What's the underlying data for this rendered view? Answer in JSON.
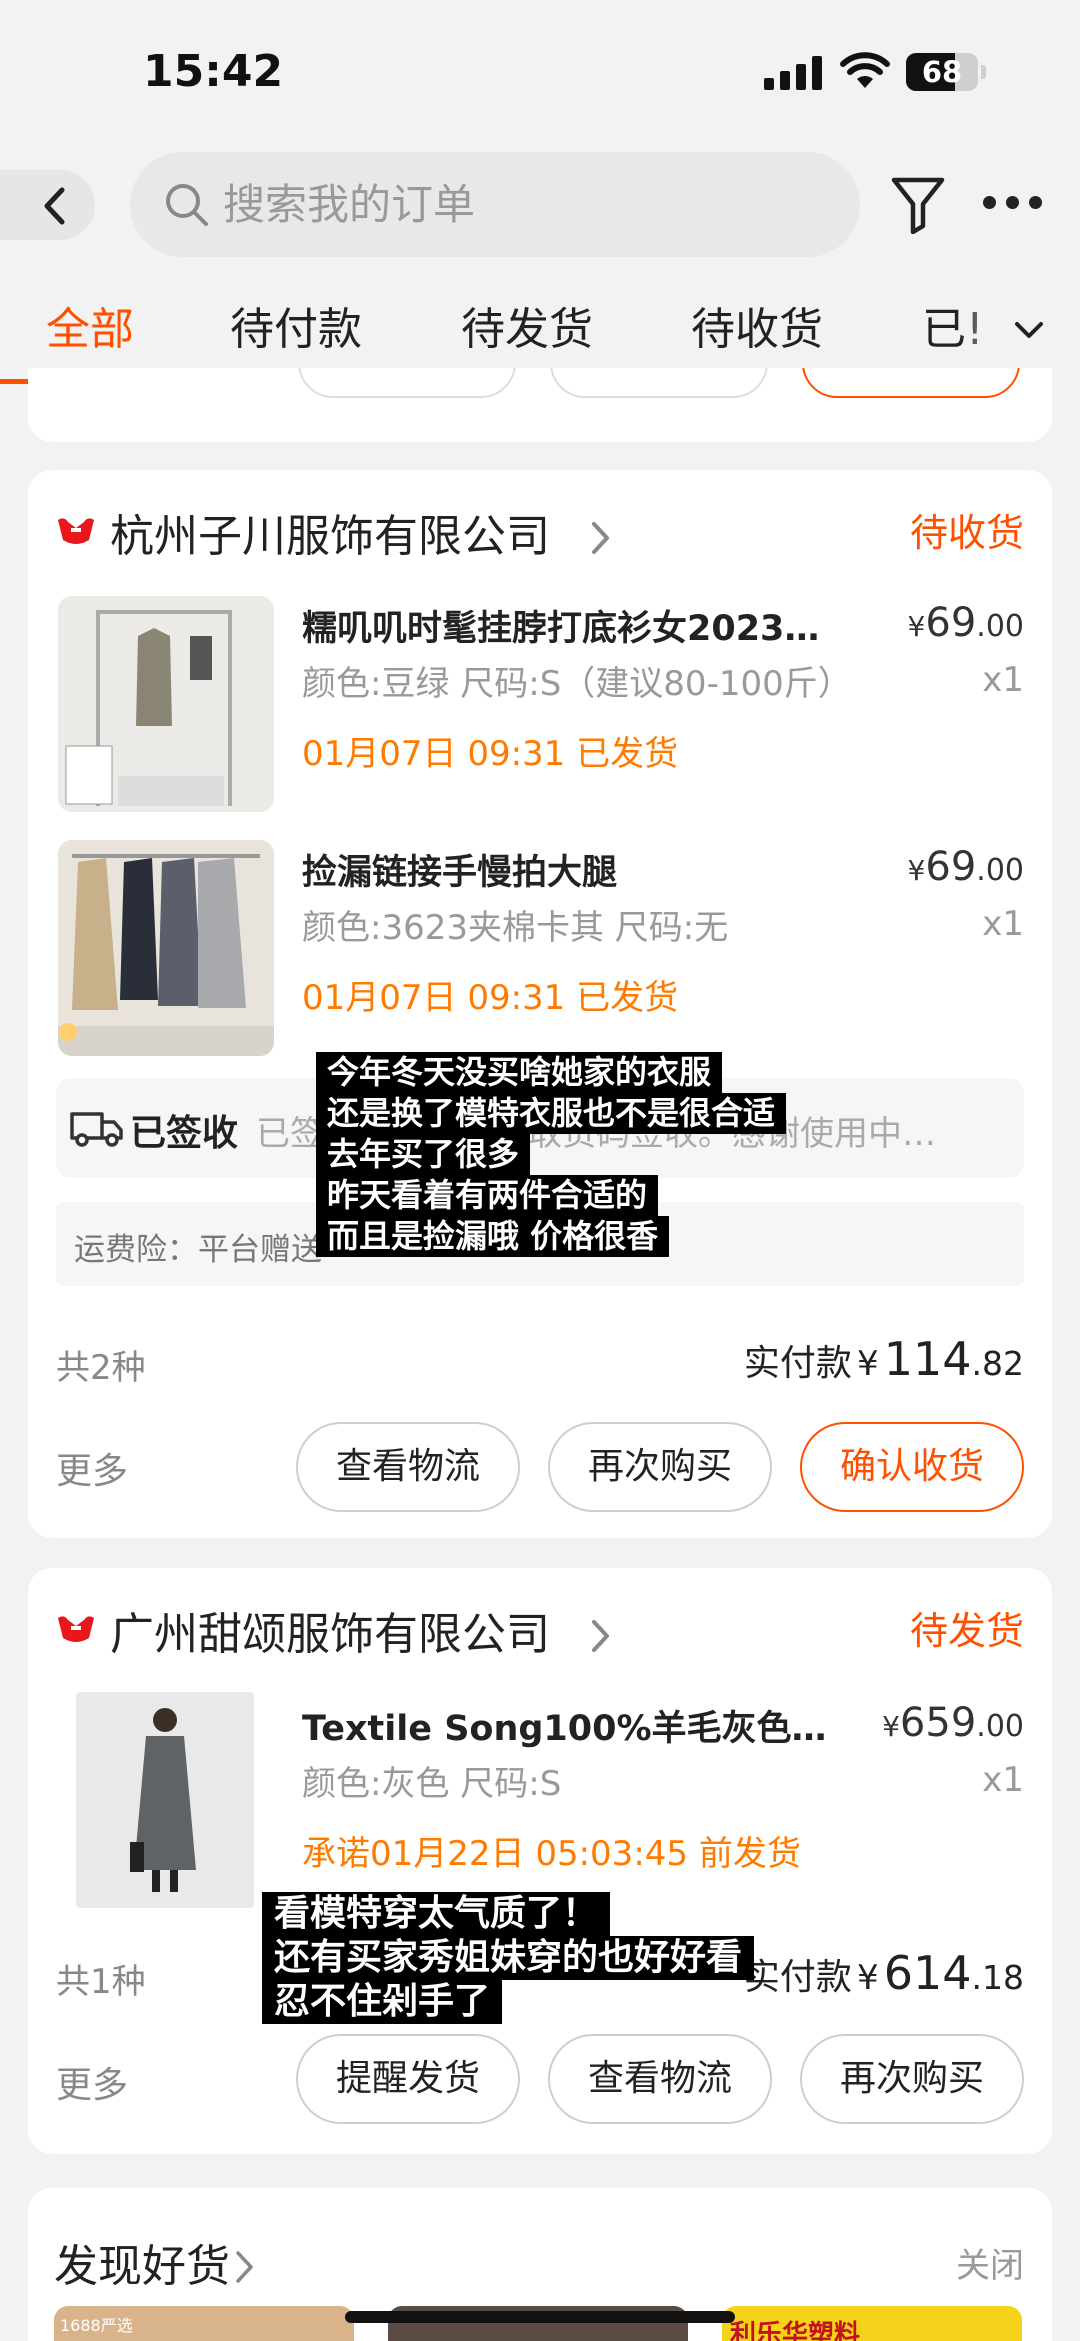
{
  "status_bar": {
    "time": "15:42",
    "battery": "68",
    "battery_level": 0.68
  },
  "search": {
    "placeholder": "搜索我的订单"
  },
  "tabs": [
    {
      "label": "全部",
      "active": true
    },
    {
      "label": "待付款"
    },
    {
      "label": "待发货"
    },
    {
      "label": "待收货"
    },
    {
      "label": "已!"
    }
  ],
  "orders": [
    {
      "shop": "杭州子川服饰有限公司",
      "status": "待收货",
      "items": [
        {
          "title": "糯叽叽时髦挂脖打底衫女2023…",
          "spec": "颜色:豆绿 尺码:S（建议80-100斤）",
          "ship": "01月07日 09:31 已发货",
          "price_int": "69",
          "price_dec": ".00",
          "currency": "¥",
          "qty": "x1"
        },
        {
          "title": "捡漏链接手慢拍大腿",
          "spec": "颜色:3623夹棉卡其 尺码:无",
          "ship": "01月07日 09:31 已发货",
          "price_int": "69",
          "price_dec": ".00",
          "currency": "¥",
          "qty": "x1"
        }
      ],
      "logistics": {
        "status": "已签收",
        "detail": "已签收，签收人凭取货码签收。感谢使用中…"
      },
      "insurance": "运费险：平台赠送",
      "count": "共2种",
      "paid_label": "实付款",
      "paid_currency": "¥",
      "paid_int": "114",
      "paid_dec": ".82",
      "more": "更多",
      "buttons": [
        "查看物流",
        "再次购买",
        "确认收货"
      ]
    },
    {
      "shop": "广州甜颂服饰有限公司",
      "status": "待发货",
      "items": [
        {
          "title": "Textile Song100%羊毛灰色…",
          "spec": "颜色:灰色 尺码:S",
          "ship": "承诺01月22日 05:03:45 前发货",
          "price_int": "659",
          "price_dec": ".00",
          "currency": "¥",
          "qty": "x1"
        }
      ],
      "count": "共1种",
      "paid_label": "实付款",
      "paid_currency": "¥",
      "paid_int": "614",
      "paid_dec": ".18",
      "more": "更多",
      "buttons": [
        "提醒发货",
        "查看物流",
        "再次购买"
      ]
    }
  ],
  "discover": {
    "title": "发现好货",
    "close": "关闭",
    "thumb_labels": [
      "1688严选",
      "利乐华塑料"
    ]
  },
  "captions": {
    "first": [
      "今年冬天没买啥她家的衣服",
      "还是换了模特衣服也不是很合适",
      "去年买了很多",
      "昨天看着有两件合适的",
      "而且是捡漏哦 价格很香"
    ],
    "second": [
      "看模特穿太气质了！",
      "还有买家秀姐妹穿的也好好看",
      "忍不住剁手了"
    ]
  },
  "colors": {
    "accent": "#ff5000",
    "ship_orange": "#ff7a00",
    "shop_logo_red": "#e8171c"
  }
}
